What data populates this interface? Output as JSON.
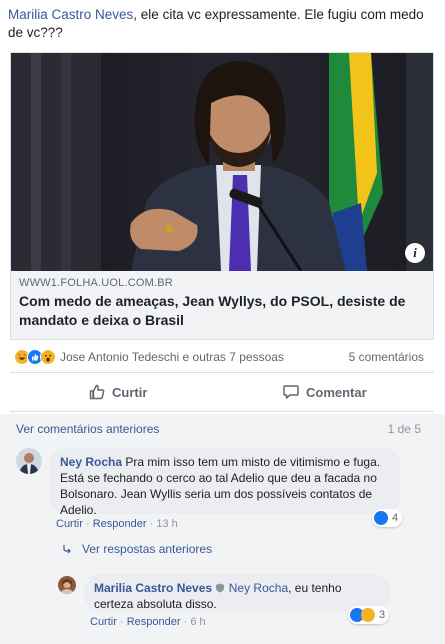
{
  "post": {
    "author": "Marilia Castro Neves",
    "text": ", ele cita vc expressamente. Ele fugiu com medo de vc???"
  },
  "link": {
    "domain": "WWW1.FOLHA.UOL.COM.BR",
    "title": "Com medo de ameaças, Jean Wyllys, do PSOL, desiste de mandato e deixa o Brasil",
    "info_icon": "i"
  },
  "reactions": {
    "icons": [
      "haha-icon",
      "like-icon",
      "wow-icon"
    ],
    "names": "Jose Antonio Tedeschi e outras 7 pessoas",
    "comments": "5 comentários"
  },
  "actions": {
    "like": "Curtir",
    "comment": "Comentar"
  },
  "comments": {
    "view_previous": "Ver comentários anteriores",
    "pager": "1 de 5",
    "first": {
      "author": "Ney Rocha",
      "text": "Pra mim isso tem um misto de vitimismo e fuga. Está se fechando o cerco ao tal Adelio que deu a facada no Bolsonaro. Jean Wyllis seria um dos possíveis contatos de Adelio.",
      "like": "Curtir",
      "separator": "·",
      "reply": "Responder",
      "time": "13 h",
      "reaction_count": "4"
    },
    "view_replies": "Ver respostas anteriores",
    "reply": {
      "author": "Marilia Castro Neves",
      "tag": "Ney Rocha",
      "text": ", eu tenho certeza absoluta disso.",
      "like": "Curtir",
      "separator": "·",
      "reply": "Responder",
      "time": "6 h",
      "reaction_count": "3"
    }
  },
  "colors": {
    "link_blue": "#385898",
    "like_blue": "#1877f2",
    "haha_yellow": "#f7b125",
    "bubble_gray": "#ebedf0"
  }
}
